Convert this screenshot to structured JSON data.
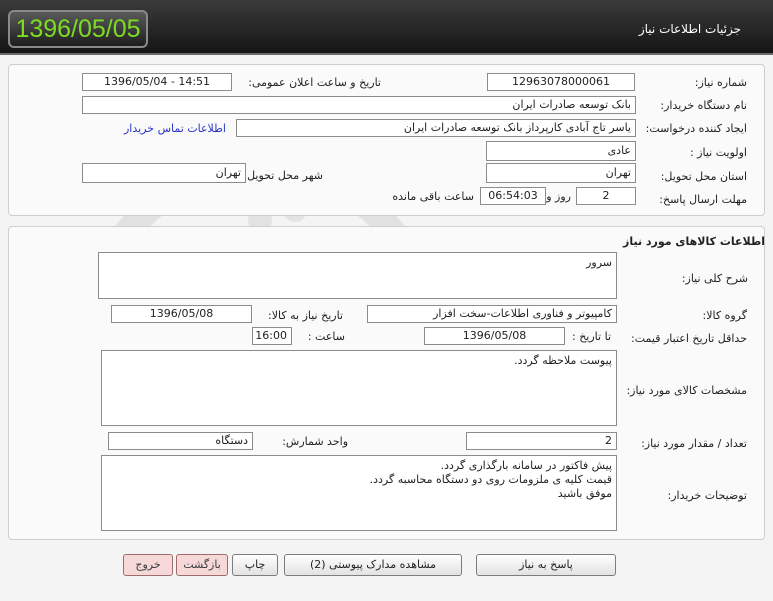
{
  "header": {
    "date": "1396/05/05",
    "title": "جزئیات اطلاعات نیاز"
  },
  "need_info": {
    "need_number_label": "شماره نیاز:",
    "need_number": "12963078000061",
    "announce_label": "تاریخ و ساعت اعلان عمومی:",
    "announce_value": "1396/05/04 - 14:51",
    "buyer_label": "نام دستگاه خریدار:",
    "buyer_value": "بانک توسعه صادرات ایران",
    "requester_label": "ایجاد کننده درخواست:",
    "requester_value": "یاسر تاج آبادی کارپرداز بانک توسعه صادرات ایران",
    "contact_link": "اطلاعات تماس خریدار",
    "priority_label": "اولویت نیاز :",
    "priority_value": "عادی",
    "province_label": "استان محل تحویل:",
    "province_value": "تهران",
    "city_label": "شهر محل تحویل:",
    "city_value": "تهران",
    "deadline_label": "مهلت ارسال پاسخ:",
    "deadline_days": "2",
    "days_word": "روز و",
    "deadline_time": "06:54:03",
    "remaining_word": "ساعت باقی مانده"
  },
  "goods": {
    "section_title": "اطلاعات کالاهای مورد نیاز",
    "description_label": "شرح کلی نیاز:",
    "description_value": "سرور",
    "group_label": "گروه کالا:",
    "group_value": "کامپیوتر و فناوری اطلاعات-سخت افزار",
    "need_date_label": "تاریخ نیاز به کالا:",
    "need_date_value": "1396/05/08",
    "validity_label": "حداقل تاریخ اعتبار قیمت:",
    "until_date_label": "تا تاریخ :",
    "until_date_value": "1396/05/08",
    "time_label": "ساعت :",
    "time_value": "16:00",
    "specs_label": "مشخصات کالای مورد نیاز:",
    "specs_value": "پیوست ملاحظه گردد.",
    "qty_label": "تعداد / مقدار مورد نیاز:",
    "qty_value": "2",
    "unit_label": "واحد شمارش:",
    "unit_value": "دستگاه",
    "buyer_notes_label": "توضیحات خریدار:",
    "buyer_notes_value": "پیش فاکتور در سامانه بارگذاری گردد.\nقیمت کلیه ی ملزومات روی دو دستگاه محاسبه گردد.\nموفق باشید"
  },
  "actions": {
    "reply": "پاسخ به نیاز",
    "attachments": "مشاهده مدارک پیوستی (2)",
    "print": "چاپ",
    "back": "بازگشت",
    "exit": "خروج"
  },
  "colors": {
    "header_date": "#7ddc1f",
    "link": "#2a33c8",
    "danger_button": "#f6d8d8"
  }
}
